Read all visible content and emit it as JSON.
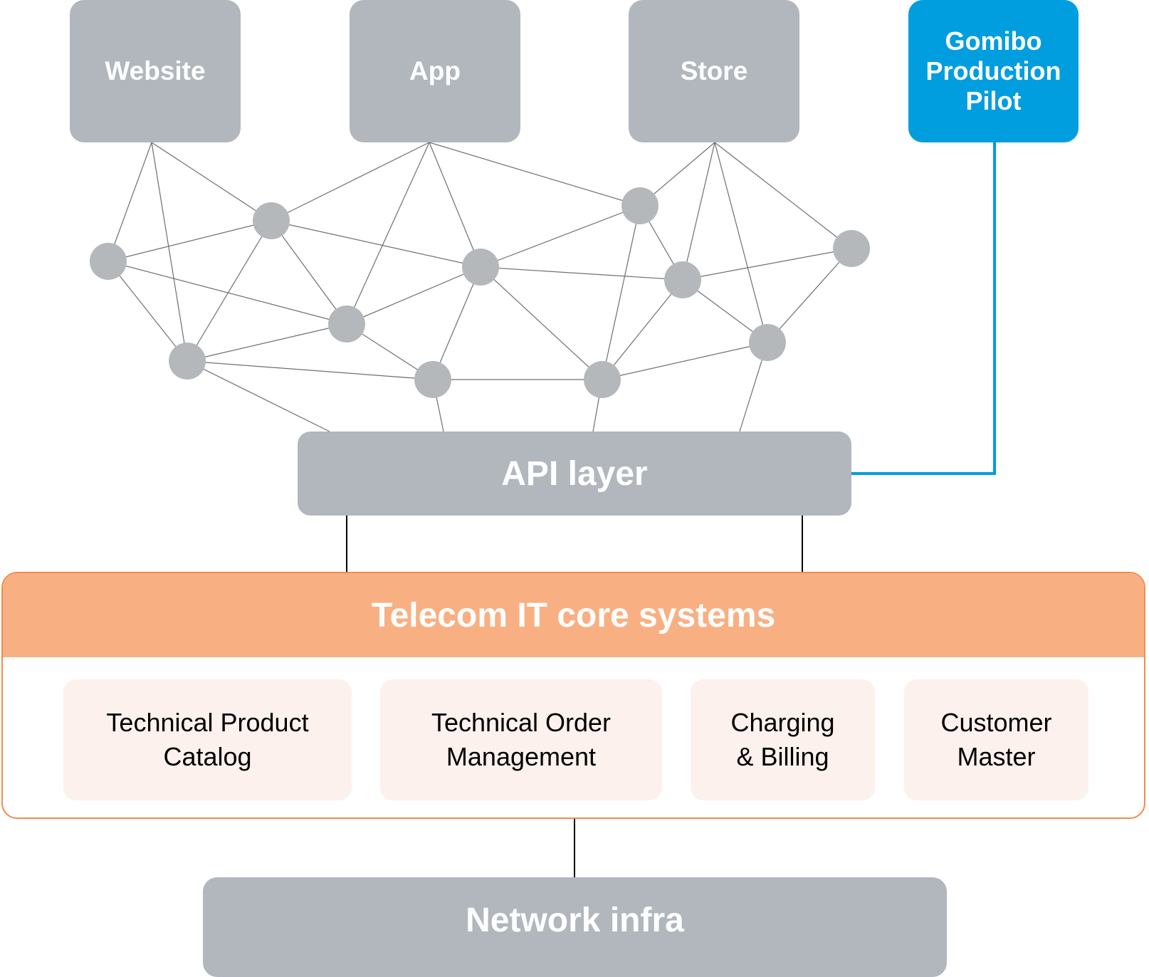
{
  "channels": [
    {
      "id": "website",
      "label": "Website"
    },
    {
      "id": "app",
      "label": "App"
    },
    {
      "id": "store",
      "label": "Store"
    }
  ],
  "pilot": {
    "label": "Gomibo\nProduction\nPilot"
  },
  "api_layer": {
    "label": "API layer"
  },
  "core": {
    "title": "Telecom IT core systems",
    "systems": [
      {
        "label": "Technical Product\nCatalog"
      },
      {
        "label": "Technical Order\nManagement"
      },
      {
        "label": "Charging\n& Billing"
      },
      {
        "label": "Customer\nMaster"
      }
    ]
  },
  "network": {
    "label": "Network infra"
  },
  "colors": {
    "grey_box": "#b1b7bd",
    "node": "#b5b8bb",
    "mesh_line": "#6f6f6f",
    "pilot_blue": "#009ede",
    "core_orange": "#f8b083",
    "core_border": "#f08c4e",
    "card_bg": "#fcf1ec",
    "connector": "#000000"
  },
  "mesh": {
    "node_count": 11,
    "edges": [
      [
        "website",
        "n1"
      ],
      [
        "website",
        "n3"
      ],
      [
        "website",
        "n2"
      ],
      [
        "app",
        "n2"
      ],
      [
        "app",
        "n4"
      ],
      [
        "app",
        "n5"
      ],
      [
        "app",
        "n7"
      ],
      [
        "store",
        "n7"
      ],
      [
        "store",
        "n8"
      ],
      [
        "store",
        "n10"
      ],
      [
        "store",
        "n9"
      ],
      [
        "n1",
        "n2"
      ],
      [
        "n1",
        "n4"
      ],
      [
        "n1",
        "n3"
      ],
      [
        "n2",
        "n3"
      ],
      [
        "n2",
        "n4"
      ],
      [
        "n2",
        "n5"
      ],
      [
        "n3",
        "n4"
      ],
      [
        "n3",
        "n6"
      ],
      [
        "n3",
        "api"
      ],
      [
        "n4",
        "n5"
      ],
      [
        "n4",
        "n6"
      ],
      [
        "n5",
        "n7"
      ],
      [
        "n5",
        "n8"
      ],
      [
        "n5",
        "n6"
      ],
      [
        "n5",
        "n11"
      ],
      [
        "n6",
        "n11"
      ],
      [
        "n6",
        "api"
      ],
      [
        "n7",
        "n8"
      ],
      [
        "n7",
        "n11"
      ],
      [
        "n8",
        "n9"
      ],
      [
        "n8",
        "n10"
      ],
      [
        "n8",
        "n11"
      ],
      [
        "n9",
        "n10"
      ],
      [
        "n10",
        "n11"
      ],
      [
        "n10",
        "api"
      ],
      [
        "n11",
        "api"
      ]
    ]
  }
}
